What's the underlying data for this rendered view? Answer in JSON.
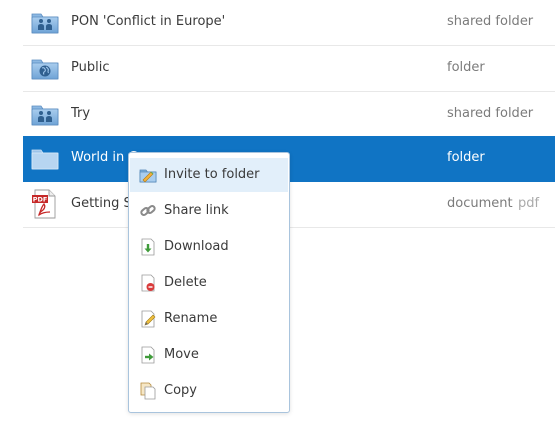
{
  "files": [
    {
      "name": "PON 'Conflict in Europe'",
      "kind": "shared folder",
      "ext": "",
      "icon": "shared-folder-icon"
    },
    {
      "name": "Public",
      "kind": "folder",
      "ext": "",
      "icon": "public-folder-icon"
    },
    {
      "name": "Try",
      "kind": "shared folder",
      "ext": "",
      "icon": "shared-folder-icon"
    },
    {
      "name": "World in C",
      "kind": "folder",
      "ext": "",
      "icon": "folder-icon",
      "selected": true
    },
    {
      "name": "Getting St",
      "kind": "document",
      "ext": "pdf",
      "icon": "pdf-icon"
    }
  ],
  "context_menu": {
    "items": [
      {
        "label": "Invite to folder",
        "icon": "invite-folder-icon",
        "highlighted": true
      },
      {
        "label": "Share link",
        "icon": "link-icon"
      },
      {
        "label": "Download",
        "icon": "download-icon"
      },
      {
        "label": "Delete",
        "icon": "delete-icon"
      },
      {
        "label": "Rename",
        "icon": "rename-icon"
      },
      {
        "label": "Move",
        "icon": "move-icon"
      },
      {
        "label": "Copy",
        "icon": "copy-icon"
      }
    ]
  },
  "colors": {
    "selection": "#1074c4",
    "menu_hover": "#e2effa",
    "folder_blue": "#7fb2de",
    "pdf_red": "#c62828"
  }
}
